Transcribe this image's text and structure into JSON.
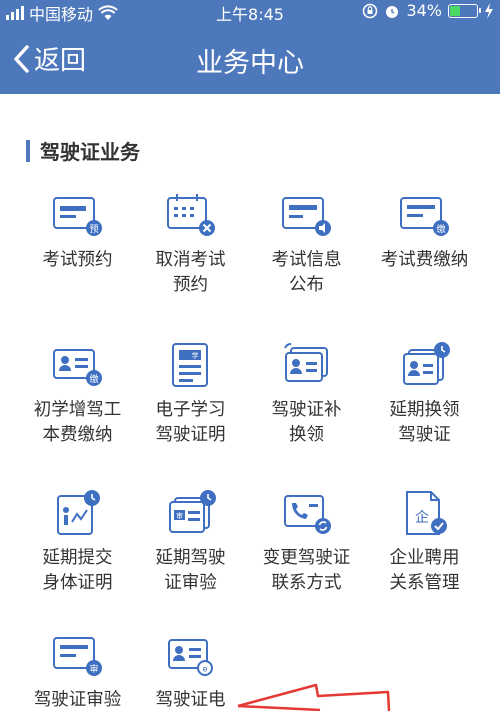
{
  "status_bar": {
    "carrier": "中国移动",
    "time": "上午8:45",
    "battery_percent": "34%",
    "battery_level": 0.34
  },
  "header": {
    "back_label": "返回",
    "title": "业务中心"
  },
  "section": {
    "title": "驾驶证业务"
  },
  "items": [
    {
      "label": "考试预约",
      "icon": "exam-appointment-icon"
    },
    {
      "label": "取消考试\n预约",
      "icon": "cancel-exam-icon"
    },
    {
      "label": "考试信息\n公布",
      "icon": "exam-info-icon"
    },
    {
      "label": "考试费缴纳",
      "icon": "exam-fee-icon"
    },
    {
      "label": "初学增驾工\n本费缴纳",
      "icon": "learner-fee-icon"
    },
    {
      "label": "电子学习\n驾驶证明",
      "icon": "e-learning-cert-icon"
    },
    {
      "label": "驾驶证补\n换领",
      "icon": "license-replace-icon"
    },
    {
      "label": "延期换领\n驾驶证",
      "icon": "extend-renew-icon"
    },
    {
      "label": "延期提交\n身体证明",
      "icon": "extend-health-icon"
    },
    {
      "label": "延期驾驶\n证审验",
      "icon": "extend-review-icon"
    },
    {
      "label": "变更驾驶证\n联系方式",
      "icon": "change-contact-icon"
    },
    {
      "label": "企业聘用\n关系管理",
      "icon": "enterprise-icon"
    },
    {
      "label": "驾驶证审验",
      "icon": "license-review-icon"
    },
    {
      "label": "驾驶证电",
      "icon": "e-license-icon"
    }
  ],
  "colors": {
    "primary": "#4d78bb",
    "icon_blue": "#3f6fc0",
    "annotation_arrow": "#e53935"
  }
}
